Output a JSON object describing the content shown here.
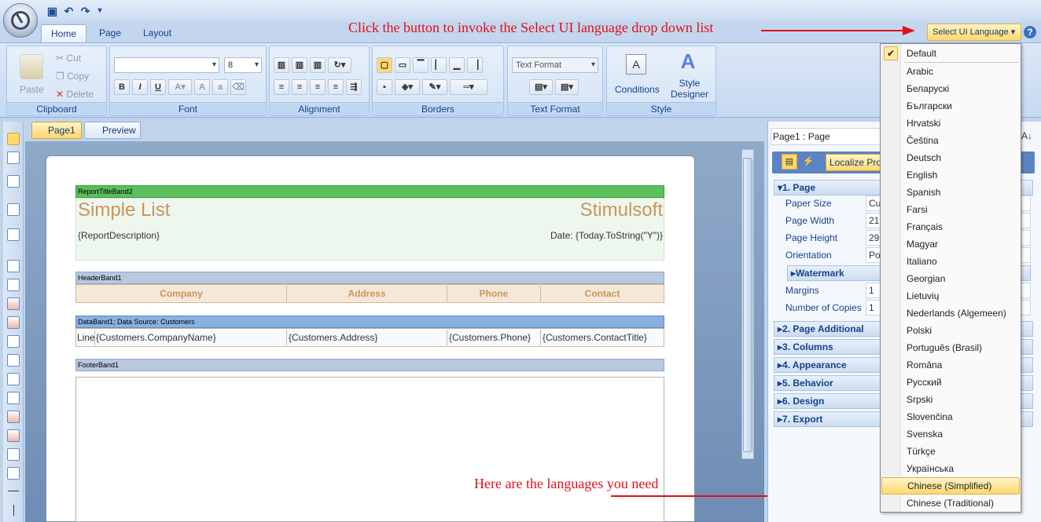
{
  "tabs": [
    "Home",
    "Page",
    "Layout"
  ],
  "annotations": {
    "top": "Click the button to invoke the Select UI language drop down list",
    "bottom": "Here are the languages you need"
  },
  "ui_lang_button": "Select UI Language",
  "help_icon": "?",
  "ribbon": {
    "clipboard": {
      "label": "Clipboard",
      "paste": "Paste",
      "cut": "Cut",
      "copy": "Copy",
      "delete": "Delete"
    },
    "font": {
      "label": "Font",
      "family": "",
      "size": "8",
      "bold": "B",
      "italic": "I",
      "underline": "U"
    },
    "alignment": {
      "label": "Alignment"
    },
    "borders": {
      "label": "Borders"
    },
    "text_format": {
      "label": "Text Format",
      "combo": "Text Format"
    },
    "style": {
      "label": "Style",
      "conditions": "Conditions",
      "designer": "Style Designer"
    }
  },
  "page_tabs": {
    "page": "Page1",
    "preview": "Preview"
  },
  "report": {
    "title_band": "ReportTitleBand2",
    "title_left": "Simple List",
    "title_right": "Stimulsoft",
    "description": "{ReportDescription}",
    "date": "Date: {Today.ToString(\"Y\")}",
    "header_band": "HeaderBand1",
    "headers": [
      "Company",
      "Address",
      "Phone",
      "Contact"
    ],
    "data_band": "DataBand1; Data Source: Customers",
    "data_line": "Line",
    "data_cells": [
      "{Customers.CompanyName}",
      "{Customers.Address}",
      "{Customers.Phone}",
      "{Customers.ContactTitle}"
    ],
    "footer_band": "FooterBand1"
  },
  "properties": {
    "title": "Page1 : Page",
    "localize_button": "Localize Pro",
    "cat_page": "1. Page",
    "rows": [
      {
        "label": "Paper Size",
        "value": "Cu"
      },
      {
        "label": "Page Width",
        "value": "21"
      },
      {
        "label": "Page Height",
        "value": "29"
      },
      {
        "label": "Orientation",
        "value": "Po"
      }
    ],
    "watermark": "Watermark",
    "rows2": [
      {
        "label": "Margins",
        "value": "1"
      },
      {
        "label": "Number of Copies",
        "value": "1"
      }
    ],
    "categories": [
      "2. Page Additional",
      "3. Columns",
      "4. Appearance",
      "5. Behavior",
      "6. Design",
      "7. Export"
    ]
  },
  "languages": [
    "Default",
    "Arabic",
    "Беларускі",
    "Български",
    "Hrvatski",
    "Čeština",
    "Deutsch",
    "English",
    "Spanish",
    "Farsi",
    "Français",
    "Magyar",
    "Italiano",
    "Georgian",
    "Lietuvių",
    "Nederlands (Algemeen)",
    "Polski",
    "Português (Brasil)",
    "Româna",
    "Русский",
    "Srpski",
    "Slovenčina",
    "Svenska",
    "Türkçe",
    "Українська",
    "Chinese (Simplified)",
    "Chinese (Traditional)"
  ],
  "highlighted_language": "Chinese (Simplified)",
  "checked_language": "Default",
  "colors": {
    "accent": "#ffd86e",
    "annotation": "#e0101a",
    "title_band": "#5bbf5b",
    "header_band": "#b7c8df",
    "data_band": "#8ab0e0"
  }
}
